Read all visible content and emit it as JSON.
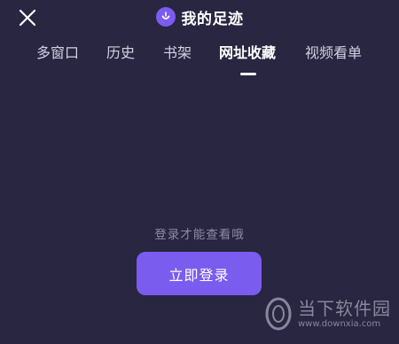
{
  "header": {
    "title": "我的足迹",
    "close_icon": "close-icon",
    "logo_icon": "smiley-face-icon"
  },
  "tabs": [
    {
      "label": "多窗口",
      "active": false
    },
    {
      "label": "历史",
      "active": false
    },
    {
      "label": "书架",
      "active": false
    },
    {
      "label": "网址收藏",
      "active": true
    },
    {
      "label": "视频看单",
      "active": false
    }
  ],
  "content": {
    "hint": "登录才能查看哦",
    "login_button": "立即登录"
  },
  "watermark": {
    "cn": "当下软件园",
    "url": "www.downxia.com"
  },
  "colors": {
    "background": "#282640",
    "accent": "#7a5cef",
    "hint_text": "#8e8ca3"
  }
}
